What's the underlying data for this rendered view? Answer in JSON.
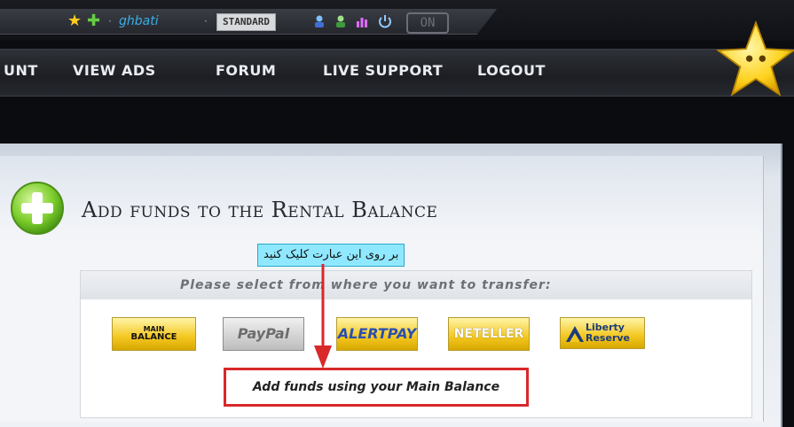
{
  "statusbar": {
    "username": "ghbati",
    "membership": "STANDARD",
    "toggle": "ON",
    "separator": "·"
  },
  "nav": {
    "items": [
      "UNT",
      "VIEW ADS",
      "FORUM",
      "LIVE SUPPORT",
      "LOGOUT"
    ]
  },
  "page": {
    "title": "Add funds to the Rental Balance",
    "instruction_callout": "بر روی این عبارت کلیک کنید",
    "select_prompt": "Please select from where you want to transfer:",
    "sources": {
      "main_balance_top": "MAIN",
      "main_balance_bottom": "BALANCE",
      "paypal": "PayPal",
      "alertpay": "ALERTPAY",
      "neteller": "NETELLER",
      "liberty_top": "Liberty",
      "liberty_bottom": "Reserve"
    },
    "action_link": "Add funds using your Main Balance"
  },
  "colors": {
    "highlight_border": "#d8282a",
    "callout_bg": "#8fe8ff",
    "username": "#38b0e6"
  },
  "icons": [
    "star-icon",
    "plus-icon",
    "user-icon",
    "user-icon",
    "stats-icon",
    "power-icon",
    "big-star-icon",
    "add-circle-icon",
    "arrow-down-icon",
    "liberty-logo-icon"
  ]
}
